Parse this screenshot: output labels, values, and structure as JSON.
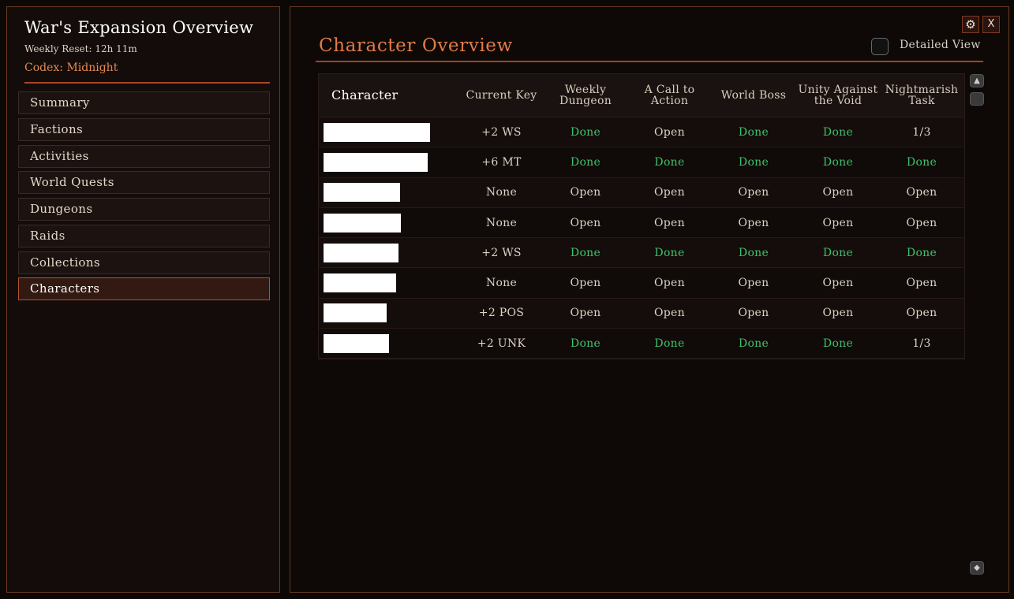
{
  "sidebar": {
    "title": "War's Expansion Overview",
    "weekly_reset": "Weekly Reset: 12h 11m",
    "codex": "Codex: Midnight",
    "items": [
      {
        "label": "Summary"
      },
      {
        "label": "Factions"
      },
      {
        "label": "Activities"
      },
      {
        "label": "World Quests"
      },
      {
        "label": "Dungeons"
      },
      {
        "label": "Raids"
      },
      {
        "label": "Collections"
      },
      {
        "label": "Characters",
        "active": true
      }
    ]
  },
  "main": {
    "page_title": "Character Overview",
    "detailed_view_label": "Detailed View",
    "detailed_view_checked": false,
    "close_label": "X",
    "gear_icon": "⚙",
    "table": {
      "headers": [
        "Character",
        "Current Key",
        "Weekly Dungeon",
        "A Call to Action",
        "World Boss",
        "Unity Against the Void",
        "Nightmarish Task"
      ],
      "rows": [
        {
          "redact_width": 135,
          "key": "+2 WS",
          "weekly": "Done",
          "call": "Open",
          "boss": "Done",
          "unity": "Done",
          "task": "1/3"
        },
        {
          "redact_width": 132,
          "key": "+6 MT",
          "weekly": "Done",
          "call": "Done",
          "boss": "Done",
          "unity": "Done",
          "task": "Done"
        },
        {
          "redact_width": 97,
          "key": "None",
          "weekly": "Open",
          "call": "Open",
          "boss": "Open",
          "unity": "Open",
          "task": "Open"
        },
        {
          "redact_width": 98,
          "key": "None",
          "weekly": "Open",
          "call": "Open",
          "boss": "Open",
          "unity": "Open",
          "task": "Open"
        },
        {
          "redact_width": 95,
          "key": "+2 WS",
          "weekly": "Done",
          "call": "Done",
          "boss": "Done",
          "unity": "Done",
          "task": "Done"
        },
        {
          "redact_width": 92,
          "key": "None",
          "weekly": "Open",
          "call": "Open",
          "boss": "Open",
          "unity": "Open",
          "task": "Open"
        },
        {
          "redact_width": 80,
          "key": "+2 POS",
          "weekly": "Open",
          "call": "Open",
          "boss": "Open",
          "unity": "Open",
          "task": "Open"
        },
        {
          "redact_width": 83,
          "key": "+2 UNK",
          "weekly": "Done",
          "call": "Done",
          "boss": "Done",
          "unity": "Done",
          "task": "1/3"
        }
      ]
    }
  },
  "colors": {
    "accent": "#e27a48",
    "done": "#3ec26a",
    "border": "#6b3a22"
  }
}
